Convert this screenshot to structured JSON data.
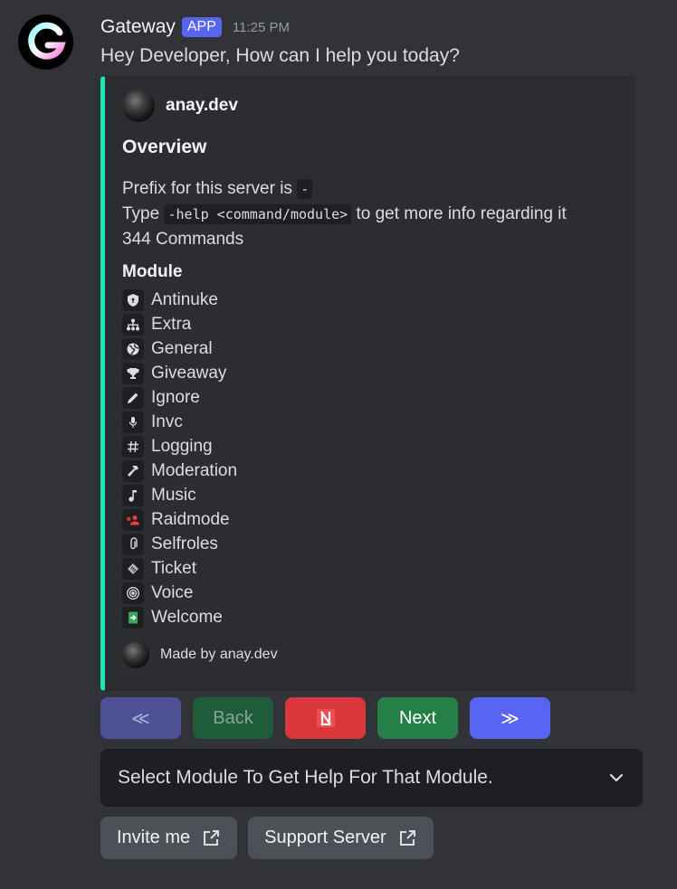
{
  "message": {
    "bot_name": "Gateway",
    "badge": "APP",
    "timestamp": "11:25 PM",
    "text": "Hey Developer, How can I help you today?"
  },
  "embed": {
    "accent_color": "#1de9b6",
    "author": "anay.dev",
    "title": "Overview",
    "prefix_line": "Prefix for this server is",
    "prefix": "-",
    "type_word": "Type",
    "help_code": "-help <command/module>",
    "help_suffix": "to get more info regarding it",
    "command_count": "344 Commands",
    "module_heading": "Module",
    "modules": [
      {
        "label": "Antinuke",
        "icon": "shield-icon"
      },
      {
        "label": "Extra",
        "icon": "hierarchy-icon"
      },
      {
        "label": "General",
        "icon": "globe-icon"
      },
      {
        "label": "Giveaway",
        "icon": "trophy-icon"
      },
      {
        "label": "Ignore",
        "icon": "pencil-icon"
      },
      {
        "label": "Invc",
        "icon": "microphone-icon"
      },
      {
        "label": "Logging",
        "icon": "hashtag-icon"
      },
      {
        "label": "Moderation",
        "icon": "hammer-icon"
      },
      {
        "label": "Music",
        "icon": "music-note-icon"
      },
      {
        "label": "Raidmode",
        "icon": "user-x-icon"
      },
      {
        "label": "Selfroles",
        "icon": "paperclip-icon"
      },
      {
        "label": "Ticket",
        "icon": "ticket-icon"
      },
      {
        "label": "Voice",
        "icon": "broadcast-icon"
      },
      {
        "label": "Welcome",
        "icon": "enter-icon"
      }
    ],
    "footer": "Made by anay.dev"
  },
  "buttons": {
    "first": "≪",
    "back": "Back",
    "next": "Next",
    "last": "≫"
  },
  "select": {
    "placeholder": "Select Module To Get Help For That Module."
  },
  "links": {
    "invite": "Invite me",
    "support": "Support Server"
  },
  "colors": {
    "background": "#313338",
    "embed_bg": "#2b2d31",
    "blurple": "#5865f2",
    "green": "#248046",
    "red": "#da373c",
    "secondary": "#4e5058"
  }
}
